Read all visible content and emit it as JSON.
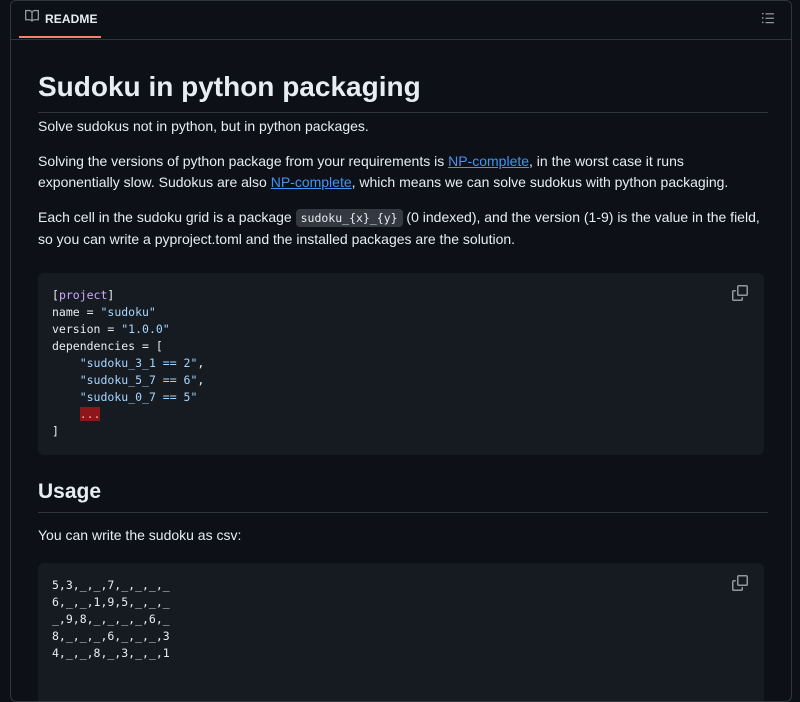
{
  "header": {
    "tab_label": "README",
    "tab_icon": "book-icon",
    "toc_icon": "list-unordered-icon"
  },
  "main": {
    "title": "Sudoku in python packaging",
    "intro": "Solve sudokus not in python, but in python packages.",
    "p2": {
      "part1": "Solving the versions of python package from your requirements is ",
      "link1": "NP-complete",
      "part2": ", in the worst case it runs exponentially slow. Sudokus are also ",
      "link2": "NP-complete",
      "part3": ", which means we can solve sudokus with python packaging."
    },
    "p3": {
      "part1": "Each cell in the sudoku grid is a package ",
      "code": "sudoku_{x}_{y}",
      "part2": " (0 indexed), and the version (1-9) is the value in the field, so you can write a pyproject.toml and the installed packages are the solution."
    },
    "code1": {
      "lines": [
        {
          "a": "[",
          "b": "project",
          "c": "]"
        },
        {
          "a": "name = ",
          "b": "\"sudoku\""
        },
        {
          "a": "version = ",
          "b": "\"1.0.0\""
        },
        {
          "a": "dependencies = ["
        },
        {
          "a": "    ",
          "b": "\"sudoku_3_1 == 2\"",
          "c": ","
        },
        {
          "a": "    ",
          "b": "\"sudoku_5_7 == 6\"",
          "c": ","
        },
        {
          "a": "    ",
          "b": "\"sudoku_0_7 == 5\""
        },
        {
          "a": "    ",
          "err": "..."
        },
        {
          "a": "]"
        }
      ]
    },
    "usage_heading": "Usage",
    "usage_text": "You can write the sudoku as csv:",
    "code2": {
      "lines": [
        "5,3,_,_,7,_,_,_,_",
        "6,_,_,1,9,5,_,_,_",
        "_,9,8,_,_,_,_,6,_",
        "8,_,_,_,6,_,_,_,3",
        "4,_,_,8,_,3,_,_,1"
      ]
    },
    "copy_icon": "copy-icon"
  },
  "colors": {
    "background": "#0d1117",
    "border": "#30363d",
    "link": "#4493f8",
    "tab_underline": "#f78166",
    "code_bg": "#161b22"
  }
}
